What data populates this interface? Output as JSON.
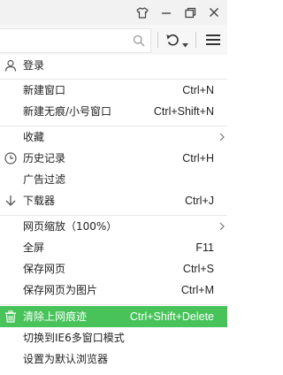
{
  "colors": {
    "highlight": "#47c35a",
    "titlebar": "#f2f2f2"
  },
  "titlebar": {
    "icons": [
      "shirt-skin-icon",
      "minimize-icon",
      "restore-icon",
      "close-icon"
    ]
  },
  "toolbar": {
    "icons": [
      "search-icon",
      "undo-icon",
      "dropdown-icon",
      "menu-icon"
    ]
  },
  "menu": {
    "login": {
      "label": "登录",
      "icon": "user-icon"
    },
    "new_window": {
      "label": "新建窗口",
      "shortcut": "Ctrl+N"
    },
    "new_incognito": {
      "label": "新建无痕/小号窗口",
      "shortcut": "Ctrl+Shift+N"
    },
    "favorites": {
      "label": "收藏"
    },
    "history": {
      "label": "历史记录",
      "shortcut": "Ctrl+H",
      "icon": "clock-icon"
    },
    "ad_filter": {
      "label": "广告过滤"
    },
    "downloads": {
      "label": "下载器",
      "shortcut": "Ctrl+J",
      "icon": "download-arrow-icon"
    },
    "zoom": {
      "label": "网页缩放（100%）"
    },
    "fullscreen": {
      "label": "全屏",
      "shortcut": "F11"
    },
    "save_page": {
      "label": "保存网页",
      "shortcut": "Ctrl+S"
    },
    "save_as_image": {
      "label": "保存网页为图片",
      "shortcut": "Ctrl+M"
    },
    "clear_traces": {
      "label": "清除上网痕迹",
      "shortcut": "Ctrl+Shift+Delete",
      "icon": "trash-icon"
    },
    "ie6_mode": {
      "label": "切换到IE6多窗口模式"
    },
    "default_browser": {
      "label": "设置为默认浏览器"
    }
  }
}
